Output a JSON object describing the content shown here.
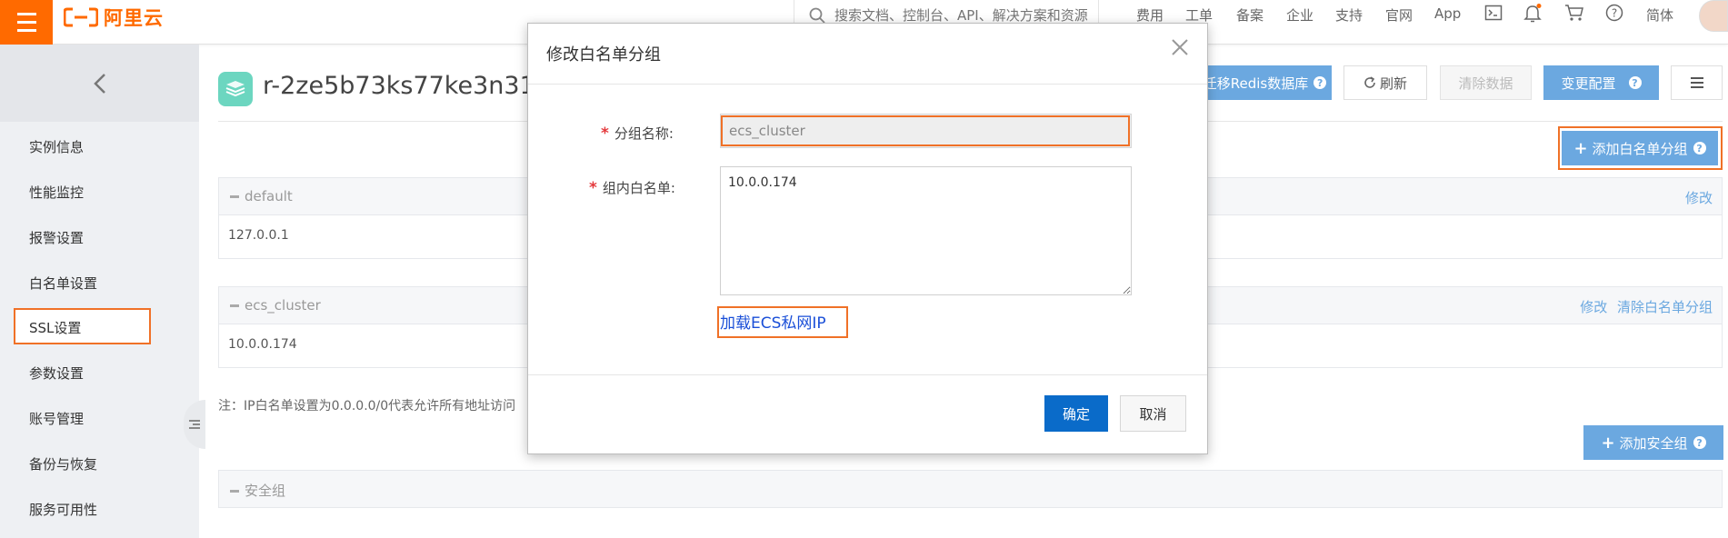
{
  "topbar": {
    "brand": "阿里云",
    "search_placeholder": "搜索文档、控制台、API、解决方案和资源",
    "nav": [
      "费用",
      "工单",
      "备案",
      "企业",
      "支持",
      "官网",
      "App"
    ],
    "lang": "简体",
    "icons": [
      "terminal-icon",
      "bell-icon",
      "cart-icon",
      "help-icon"
    ]
  },
  "sidebar": {
    "items": [
      "实例信息",
      "性能监控",
      "报警设置",
      "白名单设置",
      "SSL设置",
      "参数设置",
      "账号管理",
      "备份与恢复",
      "服务可用性"
    ],
    "active_index": 3
  },
  "main": {
    "instance_id": "r-2ze5b73ks77ke3n31",
    "header_buttons": {
      "migrate": "迁移Redis数据库",
      "refresh": "刷新",
      "clear": "清除数据",
      "change_config": "变更配置"
    },
    "add_whitelist_group": "添加白名单分组",
    "groups": [
      {
        "name": "default",
        "ips": "127.0.0.1",
        "actions": [
          "修改"
        ]
      },
      {
        "name": "ecs_cluster",
        "ips": "10.0.0.174",
        "actions": [
          "修改",
          "清除白名单分组"
        ]
      }
    ],
    "note": "注：IP白名单设置为0.0.0.0/0代表允许所有地址访问",
    "add_security_group": "添加安全组",
    "security_group_title": "安全组"
  },
  "modal": {
    "title": "修改白名单分组",
    "group_name_label": "分组名称:",
    "group_name_value": "ecs_cluster",
    "whitelist_label": "组内白名单:",
    "whitelist_value": "10.0.0.174",
    "load_ecs_link": "加载ECS私网IP",
    "confirm": "确定",
    "cancel": "取消"
  },
  "colors": {
    "brand_orange": "#ff6a00",
    "highlight_orange": "#f07127",
    "primary_blue": "#0a6bc9",
    "light_blue": "#6ba8e0"
  }
}
